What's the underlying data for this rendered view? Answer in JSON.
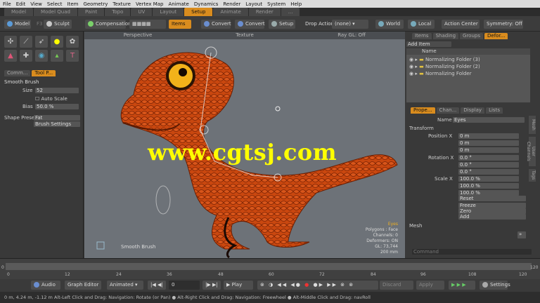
{
  "menu": [
    "File",
    "Edit",
    "View",
    "Select",
    "Item",
    "Geometry",
    "Texture",
    "Vertex Map",
    "Animate",
    "Dynamics",
    "Render",
    "Layout",
    "System",
    "Help"
  ],
  "layout_tabs": [
    "Model",
    "Model Quad",
    "Paint",
    "Topo",
    "UV",
    "Layout",
    "Setup",
    "Animate",
    "Render",
    "..."
  ],
  "active_tab": "Setup",
  "toolbar": {
    "model": "Model",
    "f3": "F3",
    "sculpt": "Sculpt",
    "compensation": "Compensation",
    "items": "Items",
    "convert1": "Convert",
    "convert2": "Convert",
    "setup": "Setup",
    "drop_action": "Drop Action",
    "none": "(none)",
    "world": "World",
    "local": "Local",
    "action_center": "Action Center",
    "symmetry": "Symmetry: Off"
  },
  "left_panel": {
    "tab1": "Comm...",
    "tab2": "Tool P...",
    "tool": "Smooth Brush",
    "size_label": "Size",
    "size_value": "52",
    "auto_scale": "Auto Scale",
    "bias_label": "Bias",
    "bias_value": "50.0 %",
    "shape_label": "Shape Preset",
    "shape_value": "Fat",
    "brush_settings": "Brush Settings"
  },
  "viewport": {
    "perspective": "Perspective",
    "texture": "Texture",
    "raygl": "Ray GL: Off",
    "tool_name": "Smooth Brush",
    "hud": [
      "Eyes",
      "Polygons : Face",
      "Channels: 0",
      "Deformers: ON",
      "GL: 73,744",
      "200 mm"
    ]
  },
  "right_panel": {
    "tabs": [
      "Items",
      "Shading",
      "Groups",
      "Defor..."
    ],
    "add_item": "Add Item",
    "name_col": "Name",
    "folders": [
      "Normalizing Folder (3)",
      "Normalizing Folder (2)",
      "Normalizing Folder"
    ],
    "prop_tabs": [
      "Prope...",
      "Chan...",
      "Display",
      "Lists"
    ],
    "name_label": "Name",
    "name_value": "Eyes",
    "transform": "Transform",
    "position": "Position X",
    "rotation": "Rotation X",
    "scale": "Scale X",
    "pos": [
      "0 m",
      "0 m",
      "0 m"
    ],
    "rot": [
      "0.0 °",
      "0.0 °",
      "0.0 °"
    ],
    "scl": [
      "100.0 %",
      "100.0 %",
      "100.0 %"
    ],
    "reset": "Reset",
    "freeze": "Freeze",
    "zero": "Zero",
    "add": "Add",
    "mesh": "Mesh",
    "command": "Command",
    "vtabs": [
      "Mesh",
      "User Channels",
      "Tags"
    ]
  },
  "timeline": {
    "labels": [
      "0",
      "12",
      "24",
      "36",
      "48",
      "60",
      "72",
      "84",
      "96",
      "108",
      "120"
    ],
    "end_labels": [
      "0",
      "120"
    ]
  },
  "transport": {
    "audio": "Audio",
    "graph": "Graph Editor",
    "animated": "Animated",
    "frame": "0",
    "play": "Play",
    "discard": "Discard",
    "apply": "Apply",
    "settings": "Settings"
  },
  "status": "0 m, 4.24 m, -1.12 m     Alt-Left Click and Drag: Navigation: Rotate (or Pan) ● Alt-Right Click and Drag: Navigation: Freewheel ● Alt-Middle Click and Drag: navRoll",
  "watermark": "www.cgtsj.com"
}
